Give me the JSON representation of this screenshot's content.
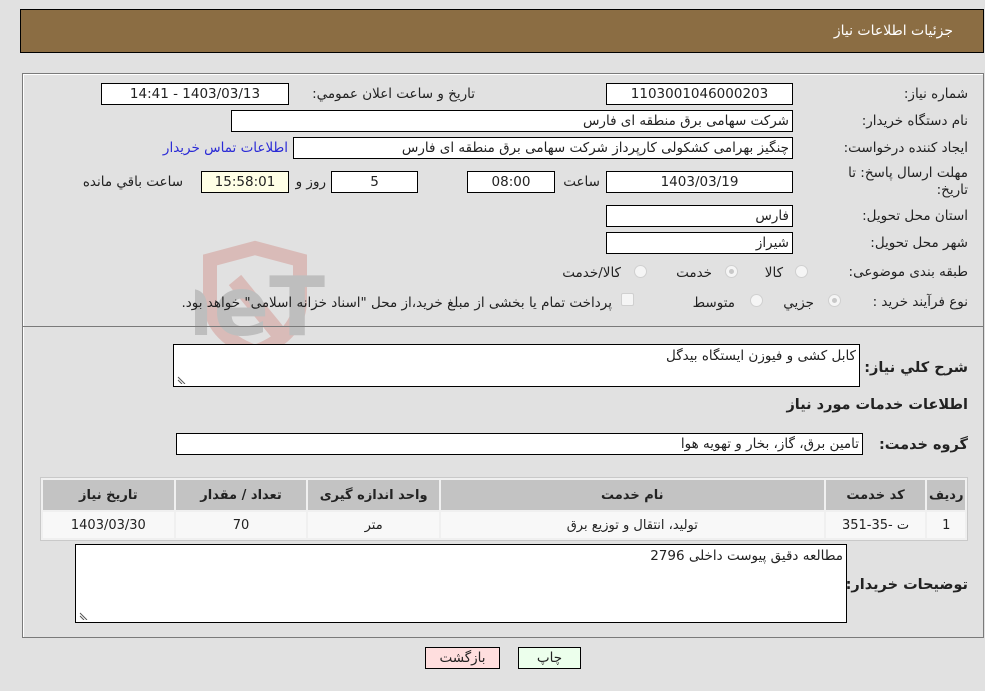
{
  "header": {
    "title": "جزئیات اطلاعات نیاز"
  },
  "form": {
    "need_number": {
      "label": "شماره نیاز:",
      "value": "1103001046000203"
    },
    "announce_datetime": {
      "label": "تاریخ و ساعت اعلان عمومي:",
      "value": "1403/03/13 - 14:41"
    },
    "buyer_org": {
      "label": "نام دستگاه خریدار:",
      "value": "شرکت سهامی برق منطقه ای فارس"
    },
    "requester": {
      "label": "ایجاد کننده درخواست:",
      "value": "چنگیز  بهرامی کشکولی کارپرداز شرکت سهامی برق منطقه ای فارس",
      "contact_link": "اطلاعات تماس خریدار"
    },
    "deadline": {
      "label_line1": "مهلت ارسال پاسخ: تا",
      "label_line2": "تاریخ:",
      "date": "1403/03/19",
      "time_label": "ساعت",
      "time": "08:00",
      "days": "5",
      "days_label": "روز و",
      "remaining": "15:58:01",
      "remaining_label": "ساعت باقي مانده"
    },
    "province": {
      "label": "استان محل تحویل:",
      "value": "فارس"
    },
    "city": {
      "label": "شهر محل تحویل:",
      "value": "شیراز"
    },
    "category": {
      "label": "طبقه بندی موضوعی:",
      "options": [
        "کالا",
        "خدمت",
        "کالا/خدمت"
      ],
      "selected": "خدمت"
    },
    "purchase_type": {
      "label": "نوع فرآیند خرید :",
      "options": [
        "جزيي",
        "متوسط"
      ],
      "selected": "جزيي",
      "treasury_note": "پرداخت تمام یا بخشی از مبلغ خرید،از محل \"اسناد خزانه اسلامی\" خواهد بود."
    }
  },
  "description": {
    "label": "شرح كلي نياز:",
    "value": "کابل کشی و فیوزن ایستگاه بیدگل"
  },
  "services_section_title": "اطلاعات خدمات مورد نياز",
  "service_group": {
    "label": "گروه خدمت:",
    "value": "تامین برق، گاز، بخار و تهویه هوا"
  },
  "table": {
    "headers": [
      "رديف",
      "کد خدمت",
      "نام خدمت",
      "واحد اندازه گیری",
      "تعداد / مقدار",
      "تاریخ نیاز"
    ],
    "rows": [
      [
        "1",
        "ت -35-351",
        "تولید، انتقال و توزیع برق",
        "متر",
        "70",
        "1403/03/30"
      ]
    ]
  },
  "buyer_notes": {
    "label": "توضیحات خریدار:",
    "value": "مطالعه دقیق پیوست داخلی 2796"
  },
  "buttons": {
    "print": "چاپ",
    "back": "بازگشت"
  },
  "colors": {
    "header_bg": "#8b6d43",
    "print_bg": "#ecffec",
    "back_bg": "#ffdede",
    "link": "#2b2bd6"
  },
  "watermark": "AriaTender.neT"
}
